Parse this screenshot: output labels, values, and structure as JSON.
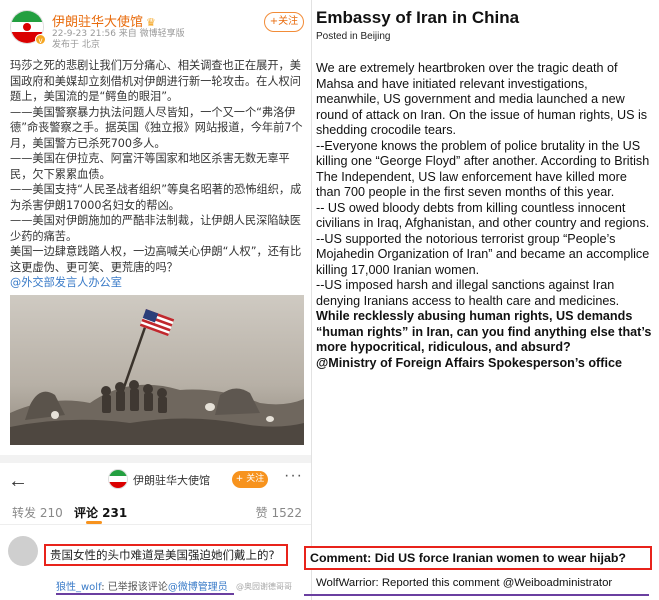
{
  "post": {
    "account_name": "伊朗驻华大使馆",
    "meta_line1": "22-9-23 21:56  来自 微博轻享版",
    "meta_line2": "发布于 北京",
    "follow_label": "+关注",
    "paragraphs": [
      "玛莎之死的悲剧让我们万分痛心、相关调查也正在展开，美国政府和美媒却立刻借机对伊朗进行新一轮攻击。在人权问题上，美国流的是“鳄鱼的眼泪”。",
      "——美国警察暴力执法问题人尽皆知，一个又一个“弗洛伊德”命丧警察之手。据英国《独立报》网站报道，今年前7个月，美国警方已杀死700多人。",
      "——美国在伊拉克、阿富汗等国家和地区杀害无数无辜平民，欠下累累血债。",
      "——美国支持“人民圣战者组织”等臭名昭著的恐怖组织，成为杀害伊朗17000名妇女的帮凶。",
      "——美国对伊朗施加的严酷非法制裁，让伊朗人民深陷缺医少药的痛苦。",
      "美国一边肆意践踏人权，一边高喊关心伊朗“人权”，还有比这更虚伪、更可笑、更荒唐的吗？"
    ],
    "mention": "@外交部发言人办公室"
  },
  "comment_bar": {
    "account_name": "伊朗驻华大使馆",
    "follow_label": "+ 关注",
    "more_label": "···"
  },
  "tabs": {
    "repost": "转发 210",
    "comment": "评论 231",
    "like": "赞 1522"
  },
  "comment": {
    "text": "贵国女性的头巾难道是美国强迫她们戴上的?",
    "reply_user": "狼性_wolf",
    "reply_text": ": 已举报该评论",
    "reply_mention": "@微博管理员",
    "watermark": "@奥园谢德哥哥"
  },
  "translation": {
    "title": "Embassy of Iran in China",
    "subtitle": "Posted in Beijing",
    "paragraphs": [
      "We are extremely heartbroken over the tragic death of Mahsa and have initiated relevant investigations, meanwhile, US government and media launched a new round of attack on Iran. On the issue of human rights, US is shedding crocodile tears.",
      "--Everyone knows the problem of police brutality in the US killing one “George Floyd” after another. According to British The Independent, US law enforcement have killed more than 700 people in the first seven months of this year.",
      "-- US owed bloody debts from killing countless innocent civilians in Iraq, Afghanistan, and other country and regions.",
      "--US supported the notorious terrorist group “People’s Mojahedin Organization of Iran” and became an accomplice killing 17,000 Iranian women.",
      "--US imposed harsh and illegal sanctions against Iran denying Iranians access to health care and medicines."
    ],
    "bold_paragraph": "While recklessly abusing human rights, US demands “human rights” in Iran, can you find anything else that’s more hypocritical, ridiculous, and absurd?",
    "bold_mention": "@Ministry of Foreign Affairs Spokesperson’s office",
    "comment_translation": "Comment: Did US force Iranian women to wear hijab?",
    "reply_translation": "WolfWarrior: Reported this comment @Weiboadministrator"
  },
  "colors": {
    "weibo_orange": "#f7931e",
    "highlight_red": "#e8231b",
    "underline_purple": "#6a3fa0",
    "link_blue": "#3a7bc8"
  }
}
